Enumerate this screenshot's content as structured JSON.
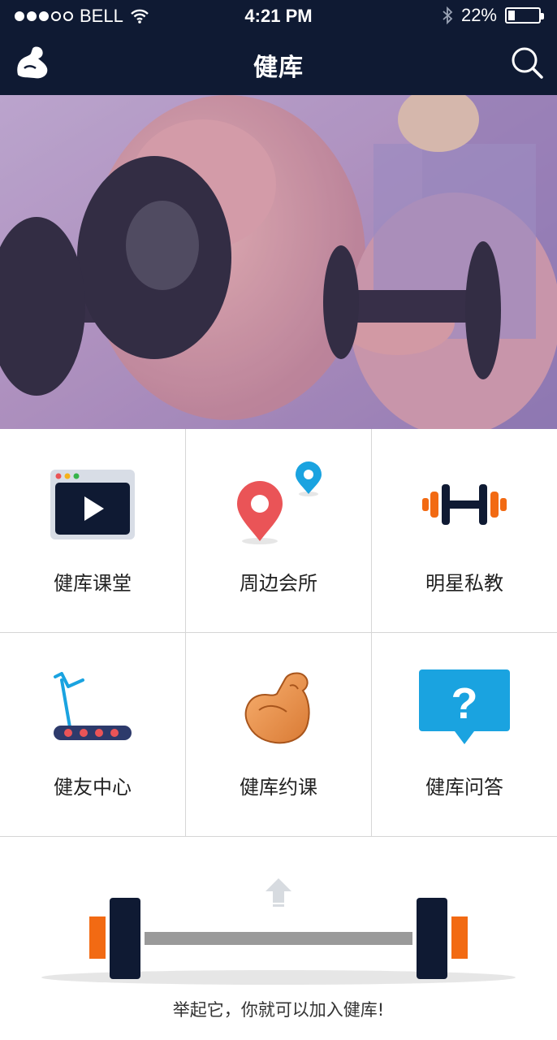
{
  "status_bar": {
    "carrier": "BELL",
    "time": "4:21 PM",
    "battery": "22%",
    "battery_level": 0.22
  },
  "nav": {
    "title": "健库",
    "logo_icon": "muscle-arm-icon",
    "search_icon": "search-icon"
  },
  "banner": {
    "image": "dumbbell-workout-photo"
  },
  "menu": [
    {
      "label": "健库课堂",
      "icon": "video-player-icon"
    },
    {
      "label": "周边会所",
      "icon": "map-pin-icon"
    },
    {
      "label": "明星私教",
      "icon": "dumbbell-icon"
    },
    {
      "label": "健友中心",
      "icon": "treadmill-icon"
    },
    {
      "label": "健库约课",
      "icon": "flexed-biceps-icon"
    },
    {
      "label": "健库问答",
      "icon": "question-bubble-icon"
    }
  ],
  "lift": {
    "arrow_icon": "up-arrow-icon",
    "barbell_icon": "barbell-icon",
    "slogan": "举起它，你就可以加入健库!"
  },
  "colors": {
    "header_bg": "#0f1a33",
    "accent_orange": "#f26a13",
    "accent_blue": "#1aa3e0",
    "accent_red": "#ea5457"
  }
}
